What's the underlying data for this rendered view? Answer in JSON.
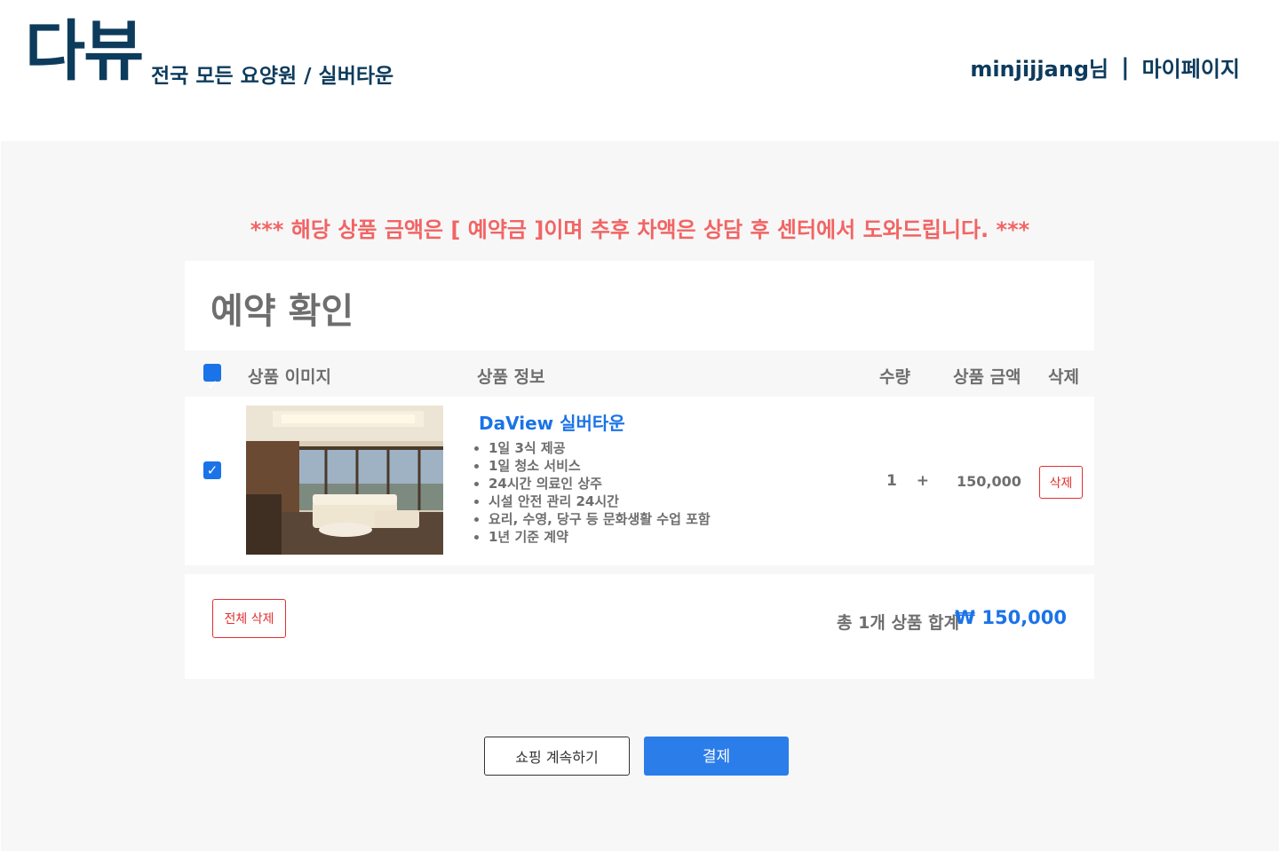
{
  "header": {
    "logo": "다뷰",
    "tagline": "전국 모든 요양원 / 실버타운",
    "username": "minjijjang님",
    "separator": "|",
    "mypage_label": "마이페이지"
  },
  "notice": "*** 해당 상품 금액은 [ 예약금 ]이며 추후 차액은 상담 후 센터에서 도와드립니다. ***",
  "page_title": "예약 확인",
  "table": {
    "select_all_checked": true,
    "columns": {
      "image": "상품 이미지",
      "info": "상품 정보",
      "quantity": "수량",
      "price": "상품 금액",
      "delete": "삭제"
    },
    "items": [
      {
        "checked": true,
        "name": "DaView 실버타운",
        "features": [
          "1일 3식 제공",
          "1일 청소 서비스",
          "24시간 의료인 상주",
          "시설 안전 관리 24시간",
          "요리, 수영, 당구 등 문화생활 수업 포함",
          "1년 기준 계약"
        ],
        "quantity": "1",
        "plus_label": "+",
        "price": "150,000",
        "delete_label": "삭제"
      }
    ]
  },
  "summary": {
    "delete_all_label": "전체 삭제",
    "total_label": "총 1개 상품 합계",
    "total_value": "₩ 150,000"
  },
  "actions": {
    "continue_label": "쇼핑 계속하기",
    "pay_label": "결제"
  },
  "colors": {
    "brand": "#0d3b5c",
    "accent": "#1a73e8",
    "notice": "#f26464",
    "danger": "#e03131",
    "pay_button": "#2b7de9"
  }
}
